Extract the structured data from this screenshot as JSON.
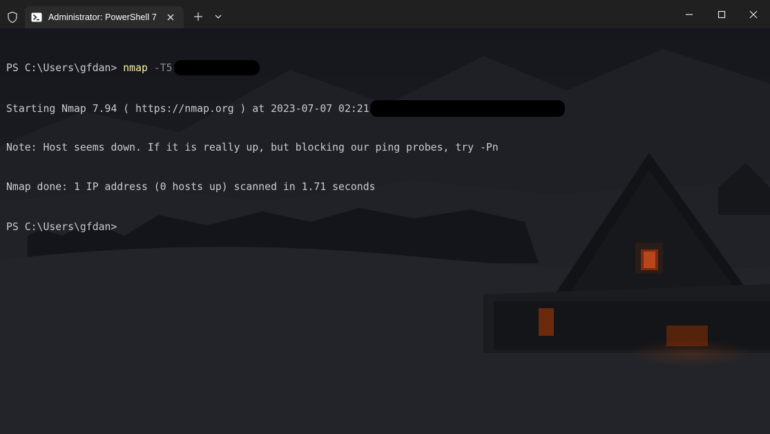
{
  "window": {
    "tab_title": "Administrator: PowerShell 7",
    "icons": {
      "shield": "shield-icon",
      "tab": "powershell-icon",
      "close_tab": "close-icon",
      "new_tab": "plus-icon",
      "dropdown": "chevron-down-icon",
      "minimize": "minimize-icon",
      "maximize": "maximize-icon",
      "close": "close-icon"
    }
  },
  "terminal": {
    "lines": [
      {
        "prompt": "PS C:\\Users\\gfdan> ",
        "command": "nmap",
        "param": " -T5"
      },
      {
        "text": "Starting Nmap 7.94 ( https://nmap.org ) at 2023-07-07 02:21"
      },
      {
        "text": "Note: Host seems down. If it is really up, but blocking our ping probes, try -Pn"
      },
      {
        "text": "Nmap done: 1 IP address (0 hosts up) scanned in 1.71 seconds"
      },
      {
        "prompt": "PS C:\\Users\\gfdan>"
      }
    ]
  },
  "colors": {
    "titlebar": "#202020",
    "tab": "#2b2b2b",
    "terminal_bg": "#17191f",
    "text": "#cccccc",
    "command": "#f9f1a5",
    "param": "#8a8a8a"
  }
}
